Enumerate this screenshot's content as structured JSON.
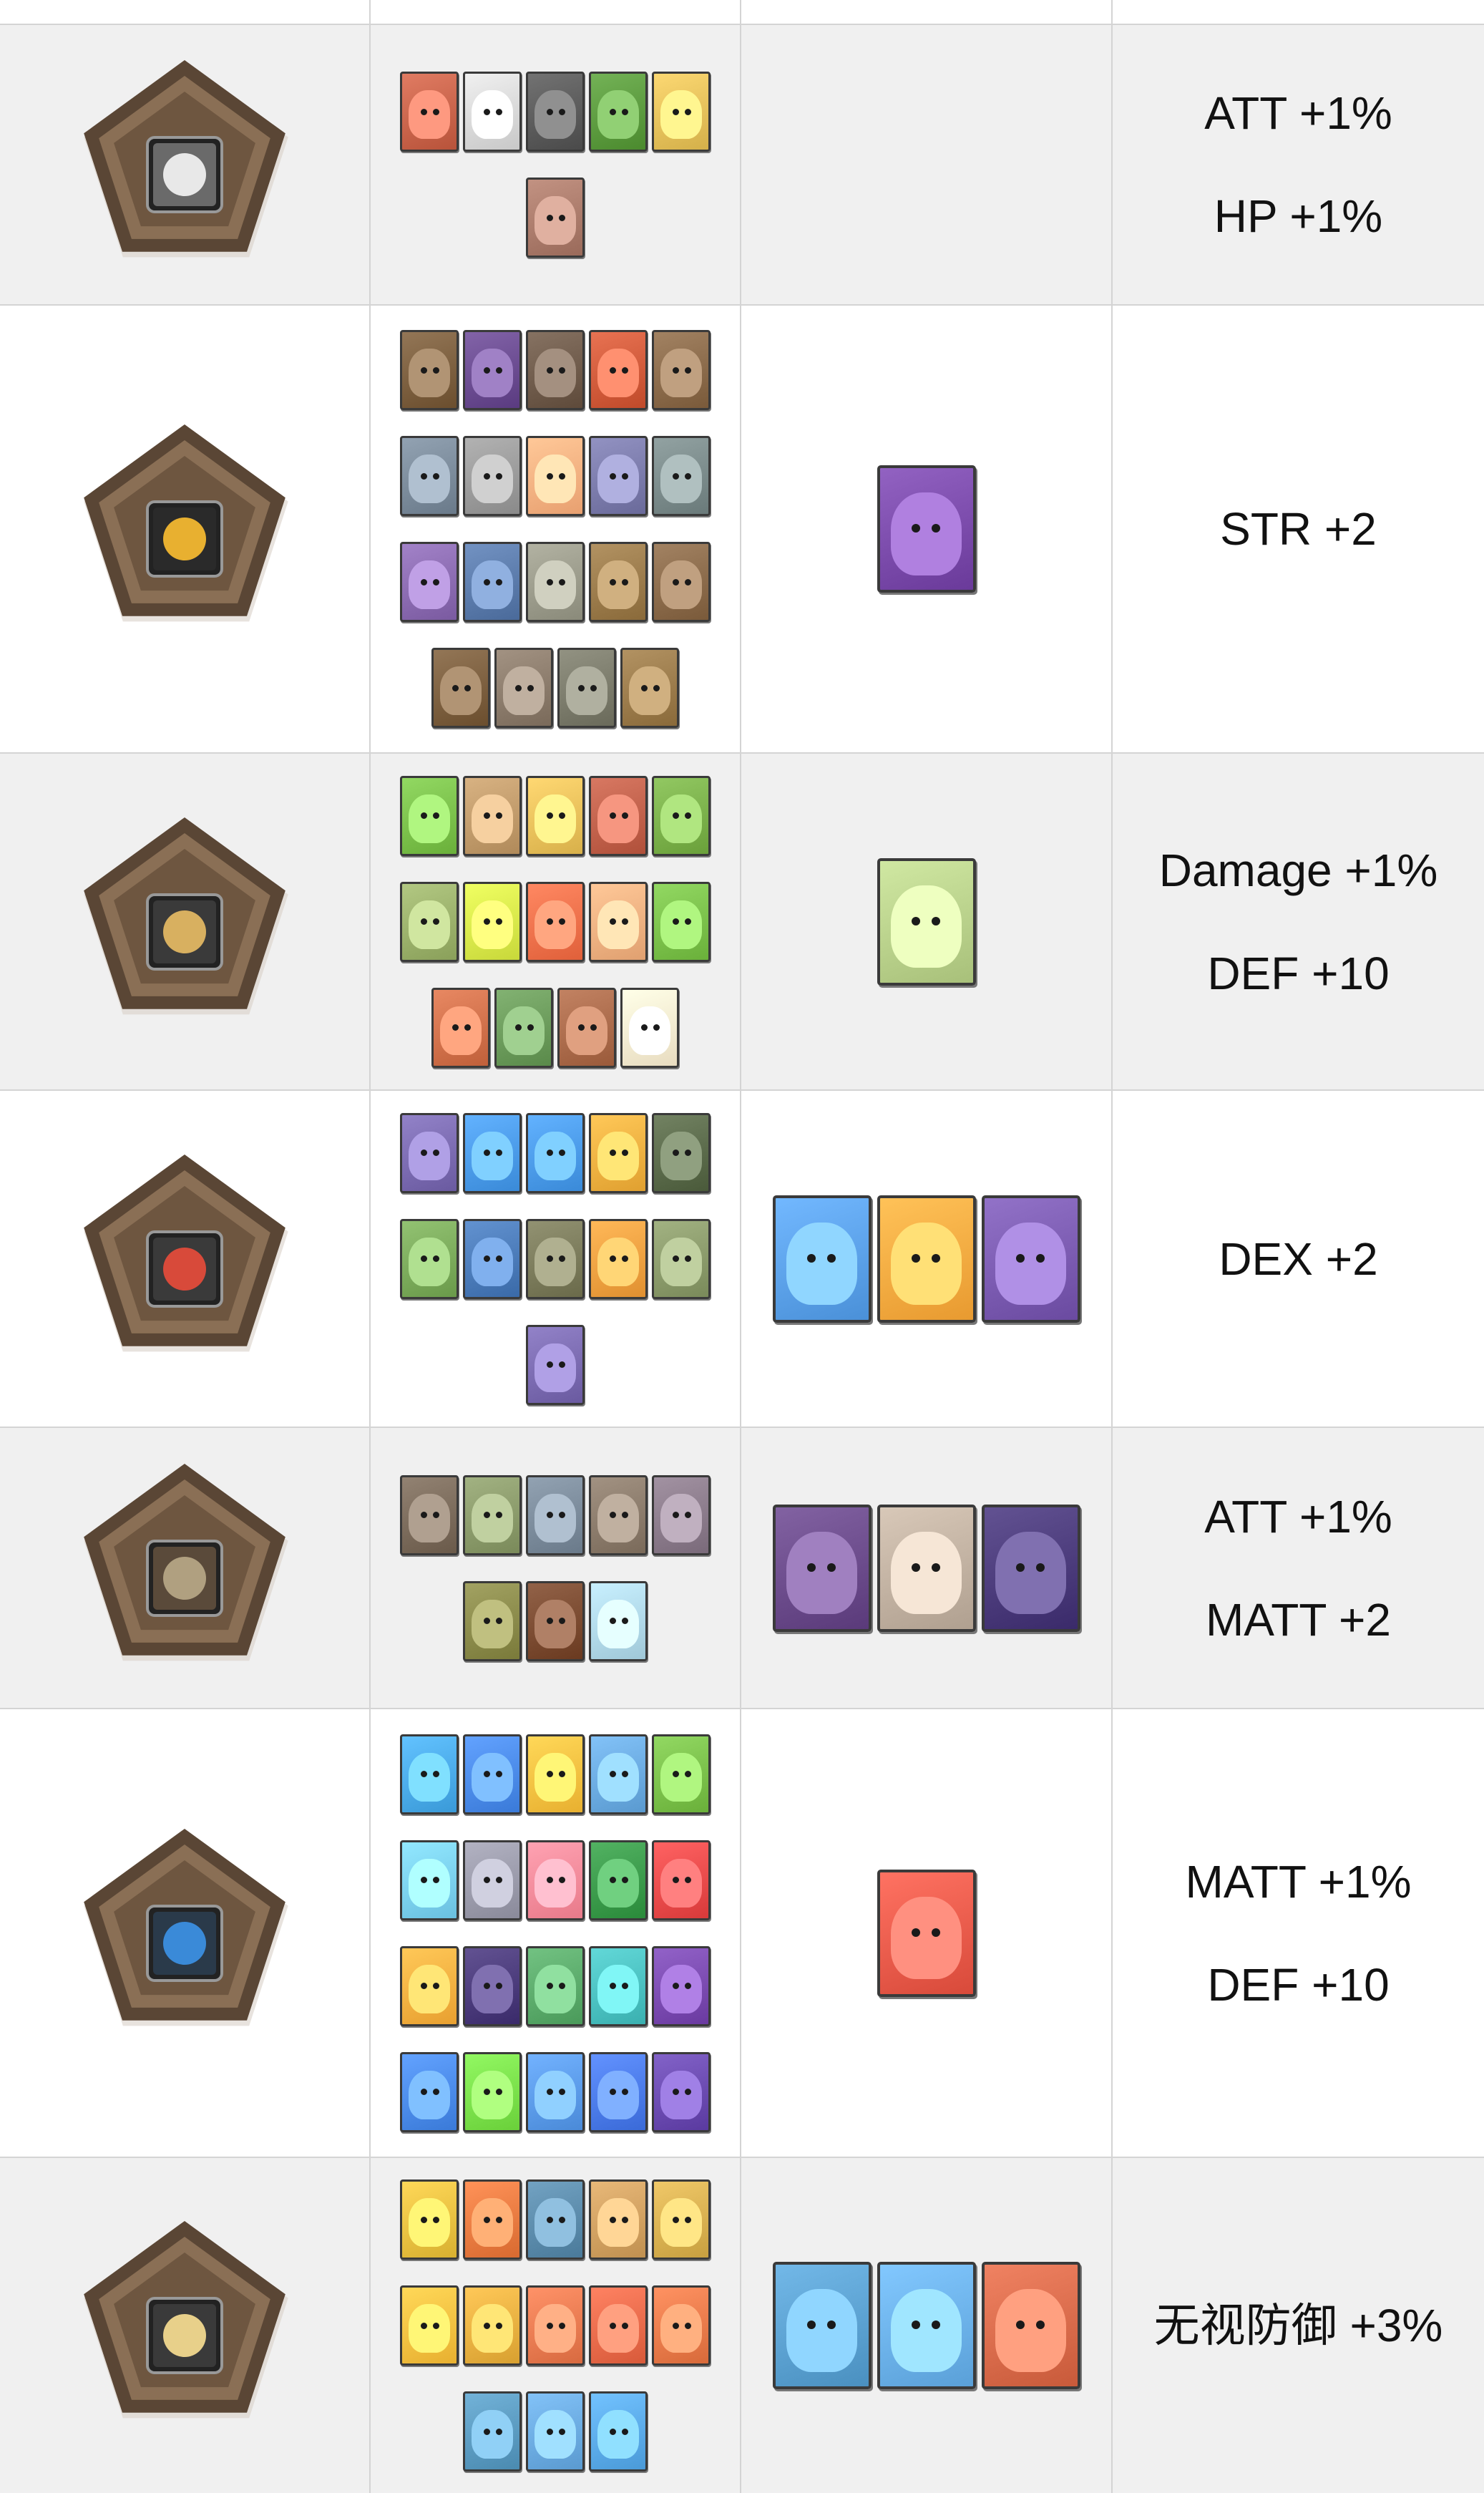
{
  "rows": [
    {
      "stats": []
    },
    {
      "badge_icon": "lion-emblem-icon",
      "stats": [
        "ATT +1%",
        "HP +1%"
      ]
    },
    {
      "badge_icon": "sun-face-emblem-icon",
      "stats": [
        "STR +2"
      ]
    },
    {
      "badge_icon": "golden-shrine-emblem-icon",
      "stats": [
        "Damage +1%",
        "DEF +10"
      ]
    },
    {
      "badge_icon": "shield-emblem-icon",
      "stats": [
        "DEX +2"
      ]
    },
    {
      "badge_icon": "stone-temple-emblem-icon",
      "stats": [
        "ATT +1%",
        "MATT +2"
      ]
    },
    {
      "badge_icon": "ocean-globe-emblem-icon",
      "stats": [
        "MATT +1%",
        "DEF +10"
      ]
    },
    {
      "badge_icon": "hourglass-shrine-emblem-icon",
      "stats": [
        "无视防御  +3%"
      ]
    }
  ],
  "colors": {
    "row_shade": "#f0f0f0",
    "row_white": "#ffffff",
    "border": "#d4d4d4",
    "badge_outer": "#5a4635",
    "badge_inner": "#8a6f55"
  },
  "cards": {
    "row1": [
      [
        "#b8533a",
        "#c8c8c8",
        "#4a4a4a",
        "#4b8a2e",
        "#d4b04a"
      ],
      [
        "#9a6a5a"
      ]
    ],
    "row2": [
      [
        "#6b4e2e",
        "#5a3b80",
        "#5e4a3a",
        "#c04a2a",
        "#7a5a3a"
      ],
      [
        "#6a7a8a",
        "#8a8a8a",
        "#e8a070",
        "#6a6a9a",
        "#6a7a7a"
      ],
      [
        "#7a5aa0",
        "#4a6a9a",
        "#8a8a7a",
        "#8a6a3a",
        "#7a5a3a"
      ],
      [
        "#6b4e2e",
        "#7a6a5a",
        "#6a6a5a",
        "#8a6a3a"
      ]
    ],
    "row2_boss": [
      "#6a3a9a"
    ],
    "row3": [
      [
        "#6ab03a",
        "#b08a5a",
        "#d8b04a",
        "#b0503a",
        "#6aa03a"
      ],
      [
        "#8aa05a",
        "#c8d83a",
        "#e0603a",
        "#e0a070",
        "#6ab03a"
      ],
      [
        "#c0603a",
        "#5a8a4a",
        "#9a5a3a",
        "#e8dcc0"
      ]
    ],
    "row3_boss": [
      "#a8c07a"
    ],
    "row4": [
      [
        "#6a5aa0",
        "#3a8ad8",
        "#3a8ad8",
        "#e0a030",
        "#4a5a3a"
      ],
      [
        "#6a9a4a",
        "#3a6aa8",
        "#6a6a4a",
        "#e09030",
        "#7a8a5a"
      ],
      [
        "#6a5aa0"
      ]
    ],
    "row4_boss": [
      "#4a90d8",
      "#e89a30",
      "#6a4aa0"
    ],
    "row5": [
      [
        "#6a5a4a",
        "#7a8a5a",
        "#6a7a8a",
        "#7a6a5a",
        "#7a6a7a"
      ],
      [
        "#7a7a3a",
        "#6a3a20",
        "#a0c8d8"
      ]
    ],
    "row5_boss": [
      "#5a3a7a",
      "#b0a090",
      "#3a2a6a"
    ],
    "row6": [
      [
        "#3a9ad8",
        "#3a7ad8",
        "#e8b030",
        "#5a9ad0",
        "#6ab03a"
      ],
      [
        "#6ac0e0",
        "#8a8a9a",
        "#e87a8a",
        "#2a8a3a",
        "#d83a3a"
      ],
      [
        "#e8a030",
        "#3a2a6a",
        "#4a9a5a",
        "#3ab0b0",
        "#6a3aa0"
      ],
      [
        "#3a7ad8",
        "#6ad03a",
        "#4a8ad8",
        "#3a6ad8",
        "#5a3aa0"
      ]
    ],
    "row6_boss": [
      "#d84a3a"
    ],
    "row7": [
      [
        "#d8b030",
        "#d86a30",
        "#4a7a9a",
        "#c09050",
        "#c8a040"
      ],
      [
        "#e8b030",
        "#d8a030",
        "#d86a40",
        "#d85a3a",
        "#d86a3a"
      ],
      [
        "#4a8ab0",
        "#5a9ad0",
        "#4a9ad8"
      ]
    ],
    "row7_boss": [
      "#4a90c0",
      "#5aa0d8",
      "#c85a3a"
    ]
  }
}
